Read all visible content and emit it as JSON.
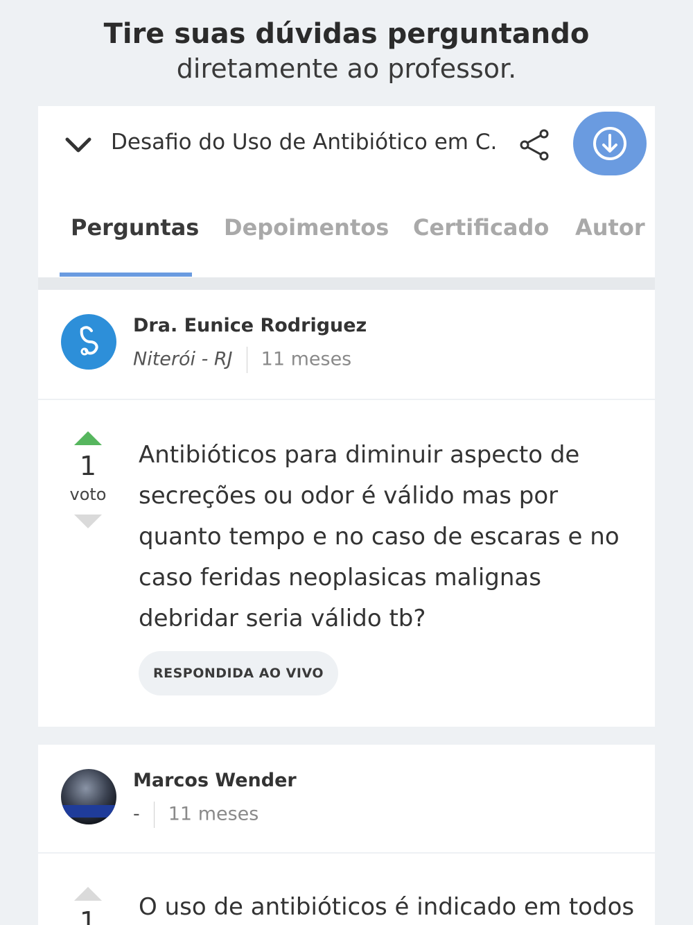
{
  "promo": {
    "line1": "Tire suas dúvidas perguntando",
    "line2": "diretamente ao professor."
  },
  "header": {
    "course_title": "Desafio do Uso de Antibiótico em C...",
    "share_icon": "share-icon",
    "download_icon": "download-icon",
    "accent_color": "#6a9be0"
  },
  "tabs": [
    {
      "label": "Perguntas",
      "active": true
    },
    {
      "label": "Depoimentos",
      "active": false
    },
    {
      "label": "Certificado",
      "active": false
    },
    {
      "label": "Autor",
      "active": false
    }
  ],
  "questions": [
    {
      "author": "Dra. Eunice Rodriguez",
      "location": "Niterói - RJ",
      "time": "11 meses",
      "avatar_icon": "stethoscope-icon",
      "votes": "1",
      "vote_label": "voto",
      "text": "Antibióticos para diminuir aspecto de secreções ou odor é válido mas por quanto tempo e no caso de escaras e no caso feridas neoplasicas malignas debridar seria válido tb?",
      "status": "RESPONDIDA AO VIVO"
    },
    {
      "author": "Marcos Wender",
      "location": "-",
      "time": "11 meses",
      "votes": "1",
      "text": "O uso de antibióticos é indicado em todos"
    }
  ]
}
